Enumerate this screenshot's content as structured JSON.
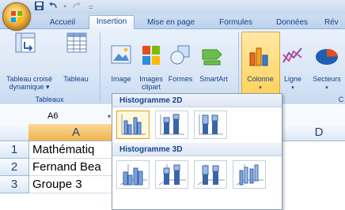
{
  "quick_access": {
    "undo_arrow": "▼",
    "separator": "="
  },
  "tabs": [
    {
      "label": "Accueil"
    },
    {
      "label": "Insertion"
    },
    {
      "label": "Mise en page"
    },
    {
      "label": "Formules"
    },
    {
      "label": "Données"
    },
    {
      "label": "Rév"
    }
  ],
  "ribbon": {
    "groups": {
      "tableaux": "Tableaux",
      "illustrations_partial": "",
      "charts_partial": "C"
    },
    "buttons": {
      "tableau_croise": [
        "Tableau croisé",
        "dynamique ▾"
      ],
      "tableau": "Tableau",
      "image": "Image",
      "images_clipart": [
        "Images",
        "clipart"
      ],
      "formes": "Formes",
      "smartart": "SmartArt",
      "colonne": "Colonne",
      "ligne": "Ligne",
      "secteurs": "Secteurs"
    }
  },
  "formula_bar": {
    "cell_ref": "A6"
  },
  "grid": {
    "columns": [
      "A",
      "D"
    ],
    "rows": [
      {
        "num": "1",
        "a": "Mathématiq"
      },
      {
        "num": "2",
        "a": "Fernand Bea"
      },
      {
        "num": "3",
        "a": "Groupe 3"
      }
    ]
  },
  "dropdown": {
    "section_2d": "Histogramme 2D",
    "section_3d": "Histogramme 3D"
  },
  "colors": {
    "accent": "#15428b",
    "highlight": "#ffd25c",
    "selection": "#f2b54a"
  }
}
